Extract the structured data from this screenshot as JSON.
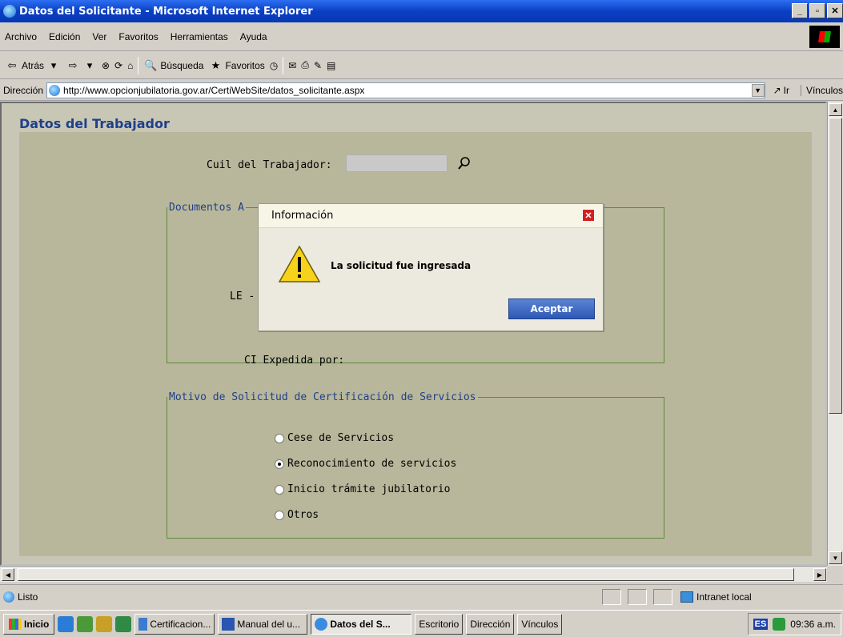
{
  "window": {
    "title": "Datos del Solicitante - Microsoft Internet Explorer",
    "minimize": "_",
    "restore": "▫",
    "close": "✕"
  },
  "menu": [
    "Archivo",
    "Edición",
    "Ver",
    "Favoritos",
    "Herramientas",
    "Ayuda"
  ],
  "toolbar": {
    "back": "Atrás",
    "search": "Búsqueda",
    "favorites": "Favoritos"
  },
  "address": {
    "label": "Dirección",
    "url": "http://www.opcionjubilatoria.gov.ar/CertiWebSite/datos_solicitante.aspx",
    "go": "Ir",
    "links": "Vínculos"
  },
  "page": {
    "title": "Datos del Trabajador",
    "cuil_label": "Cuil del Trabajador:",
    "documents_legend": "Documentos A",
    "le_label": "LE -",
    "ci_label": "CI Expedida por:",
    "motivo_legend": "Motivo de Solicitud de Certificación de Servicios",
    "options": [
      {
        "label": "Cese de Servicios",
        "checked": false
      },
      {
        "label": "Reconocimiento de servicios",
        "checked": true
      },
      {
        "label": "Inicio trámite jubilatorio",
        "checked": false
      },
      {
        "label": "Otros",
        "checked": false
      }
    ]
  },
  "dialog": {
    "title": "Información",
    "message": "La solicitud fue ingresada",
    "ok": "Aceptar"
  },
  "status": {
    "text": "Listo",
    "zone": "Intranet local"
  },
  "taskbar": {
    "start": "Inicio",
    "tasks": [
      "Certificacion...",
      "Manual del u...",
      "Datos del S..."
    ],
    "extras": [
      "Escritorio",
      "Dirección",
      "Vínculos"
    ],
    "lang": "ES",
    "time": "09:36 a.m."
  }
}
